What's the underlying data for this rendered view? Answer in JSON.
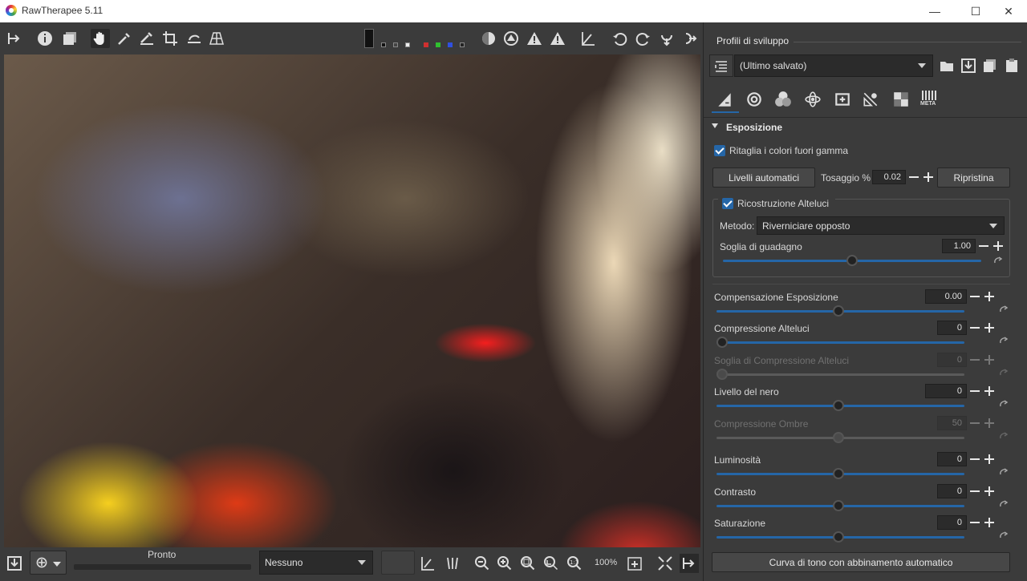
{
  "window": {
    "title": "RawTherapee 5.11",
    "minimize": "—",
    "maximize": "☐",
    "close": "✕"
  },
  "toolbar": {
    "icons": [
      "panel-collapse-icon",
      "info-icon",
      "before-after-icon",
      "hand-icon",
      "color-picker-icon",
      "white-balance-picker-icon",
      "crop-icon",
      "straighten-icon",
      "perspective-icon"
    ],
    "preview_icons": [
      "channel-r-icon",
      "channel-g-icon",
      "channel-b-icon",
      "luminance-icon",
      "focus-mask-icon",
      "shadow-clip-icon",
      "highlight-clip-icon"
    ]
  },
  "bottom": {
    "status": "Pronto",
    "profile_select": "Nessuno",
    "zoom": "100%"
  },
  "panel": {
    "profiles_label": "Profili di sviluppo",
    "profile_value": "(Ultimo salvato)",
    "section_title": "Esposizione",
    "clip_gamut_label": "Ritaglia i colori fuori gamma",
    "auto_levels": "Livelli automatici",
    "clip_label": "Tosaggio %",
    "clip_value": "0.02",
    "reset": "Ripristina",
    "hl_recon_label": "Ricostruzione Alteluci",
    "method_label": "Metodo:",
    "method_value": "Riverniciare opposto",
    "gain_threshold_label": "Soglia di guadagno",
    "gain_threshold_value": "1.00",
    "sliders": [
      {
        "label": "Compensazione Esposizione",
        "value": "0.00",
        "level": 0.5,
        "enabled": true
      },
      {
        "label": "Compressione Alteluci",
        "value": "0",
        "level": 0.0,
        "enabled": true
      },
      {
        "label": "Soglia di Compressione Alteluci",
        "value": "0",
        "level": 0.0,
        "enabled": false
      },
      {
        "label": "Livello del nero",
        "value": "0",
        "level": 0.5,
        "enabled": true
      },
      {
        "label": "Compressione Ombre",
        "value": "50",
        "level": 0.5,
        "enabled": false
      },
      {
        "label": "Luminosità",
        "value": "0",
        "level": 0.5,
        "enabled": true
      },
      {
        "label": "Contrasto",
        "value": "0",
        "level": 0.5,
        "enabled": true
      },
      {
        "label": "Saturazione",
        "value": "0",
        "level": 0.5,
        "enabled": true
      }
    ],
    "tone_curve_button": "Curva di tono con abbinamento automatico",
    "meta_tab": "META"
  }
}
